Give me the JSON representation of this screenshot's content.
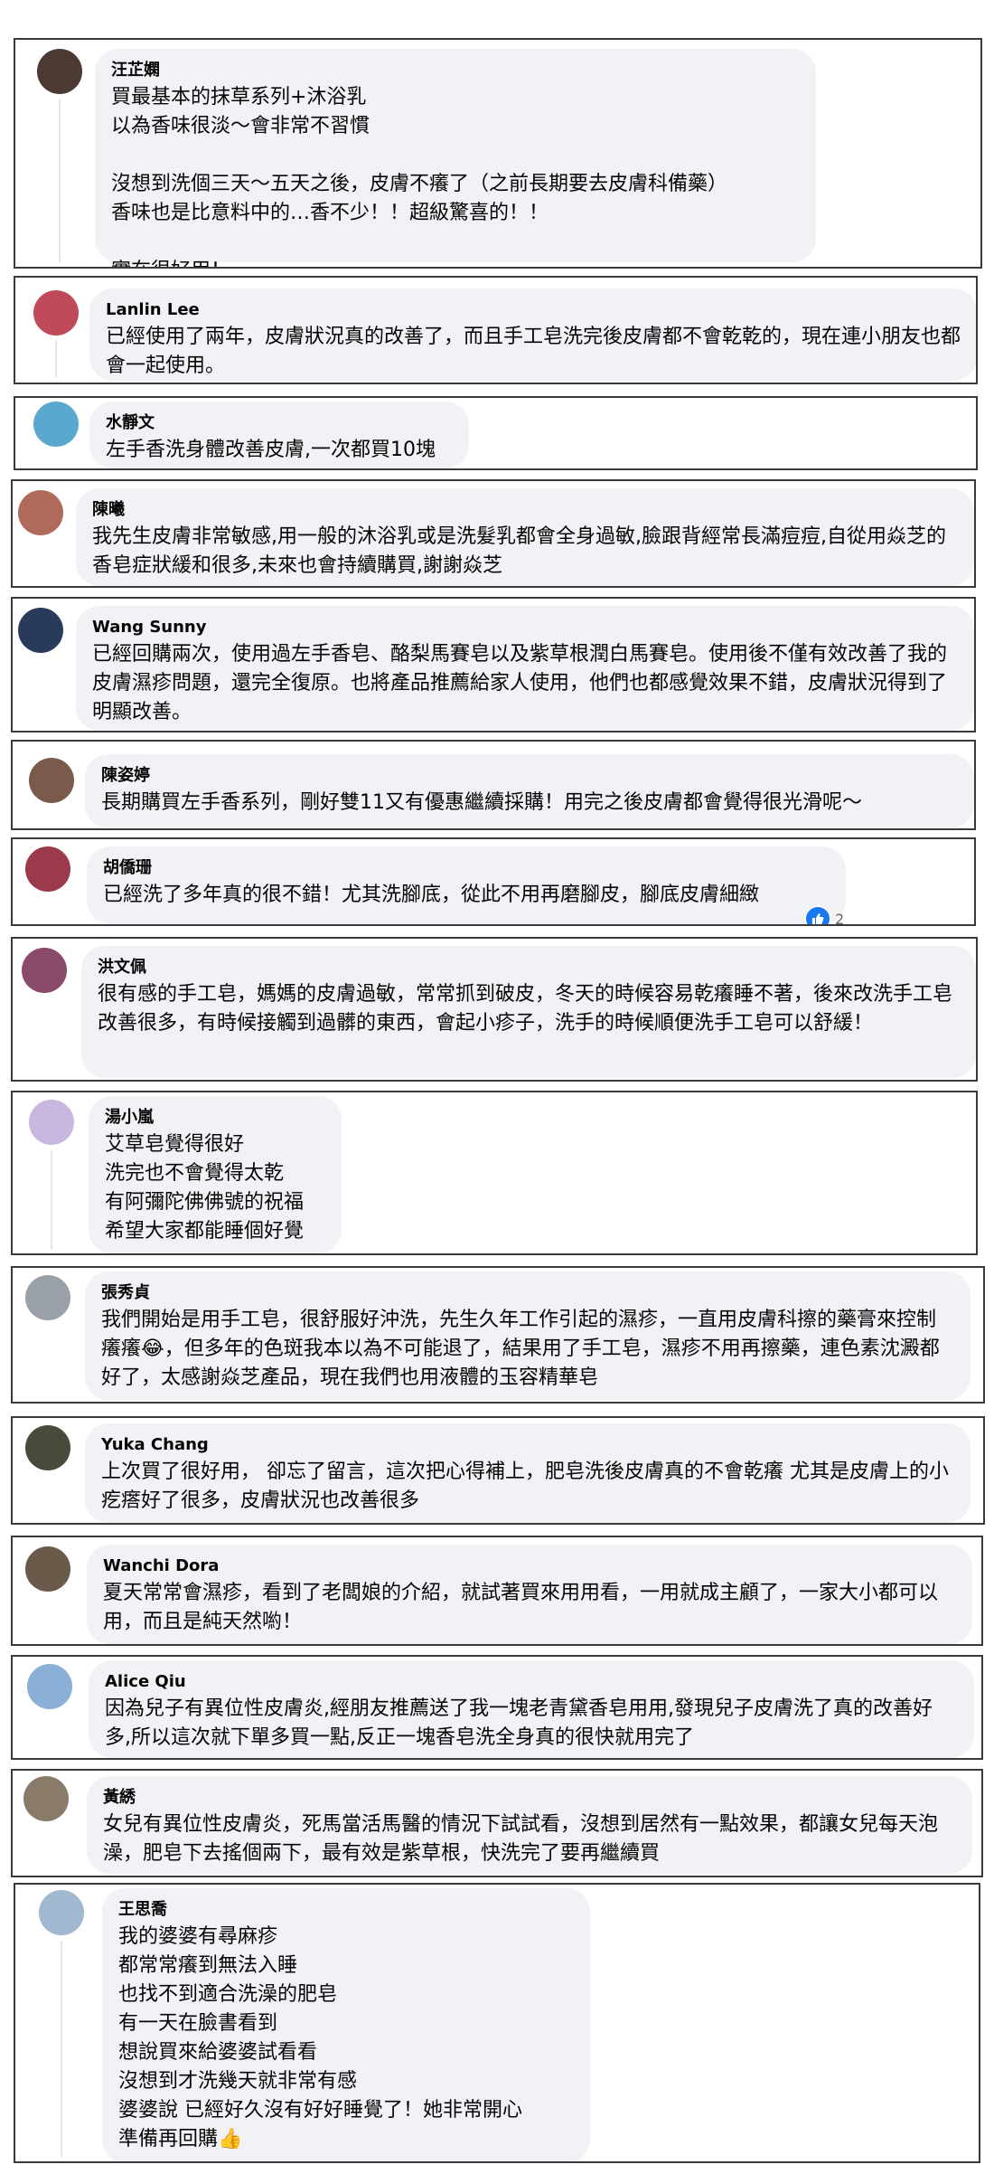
{
  "comments": [
    {
      "name": "汪芷嫻",
      "text": "買最基本的抹草系列+沐浴乳\n以為香味很淡～會非常不習慣\n\n沒想到洗個三天～五天之後，皮膚不癢了（之前長期要去皮膚科備藥）\n香味也是比意料中的…香不少！！超級驚喜的！！\n\n實在很好用！",
      "avatar_color": "#4a3a32"
    },
    {
      "name": "Lanlin Lee",
      "text": "已經使用了兩年，皮膚狀況真的改善了，而且手工皂洗完後皮膚都不會乾乾的，現在連小朋友也都會一起使用。",
      "avatar_color": "#c04a5a"
    },
    {
      "name": "水靜文",
      "text": "左手香洗身體改善皮膚,一次都買10塊",
      "avatar_color": "#5aa8d0"
    },
    {
      "name": "陳曦",
      "text": "我先生皮膚非常敏感,用一般的沐浴乳或是洗髮乳都會全身過敏,臉跟背經常長滿痘痘,自從用焱芝的香皂症狀緩和很多,未來也會持續購買,謝謝焱芝",
      "avatar_color": "#b06a5a"
    },
    {
      "name": "Wang Sunny",
      "text": "已經回購兩次，使用過左手香皂、酪梨馬賽皂以及紫草根潤白馬賽皂。使用後不僅有效改善了我的皮膚濕疹問題，還完全復原。也將產品推薦給家人使用，他們也都感覺效果不錯，皮膚狀況得到了明顯改善。",
      "avatar_color": "#2a3a5a"
    },
    {
      "name": "陳姿婷",
      "text": "長期購買左手香系列，剛好雙11又有優惠繼續採購！用完之後皮膚都會覺得很光滑呢～",
      "avatar_color": "#7a5a4a"
    },
    {
      "name": "胡僑珊",
      "text": "已經洗了多年真的很不錯！尤其洗腳底，從此不用再磨腳皮，腳底皮膚細緻",
      "avatar_color": "#9a3a4a",
      "reaction_count": "2"
    },
    {
      "name": "洪文佩",
      "text": "很有感的手工皂，媽媽的皮膚過敏，常常抓到破皮，冬天的時候容易乾癢睡不著，後來改洗手工皂改善很多，有時候接觸到過髒的東西，會起小疹子，洗手的時候順便洗手工皂可以舒緩！",
      "avatar_color": "#8a4a6a"
    },
    {
      "name": "湯小嵐",
      "text": "艾草皂覺得很好\n洗完也不會覺得太乾\n有阿彌陀佛佛號的祝福\n希望大家都能睡個好覺",
      "avatar_color": "#c8b8e0"
    },
    {
      "name": "張秀貞",
      "text": "我們開始是用手工皂，很舒服好沖洗，先生久年工作引起的濕疹，一直用皮膚科擦的藥膏來控制癢癢😂，但多年的色斑我本以為不可能退了，結果用了手工皂，濕疹不用再擦藥，連色素沈澱都好了，太感謝焱芝產品，現在我們也用液體的玉容精華皂",
      "avatar_color": "#9aa0a8"
    },
    {
      "name": "Yuka Chang",
      "text": "上次買了很好用， 卻忘了留言，這次把心得補上，肥皂洗後皮膚真的不會乾癢 尤其是皮膚上的小疙瘩好了很多，皮膚狀況也改善很多",
      "avatar_color": "#4a4a3a"
    },
    {
      "name": "Wanchi Dora",
      "text": "夏天常常會濕疹，看到了老闆娘的介紹，就試著買來用用看，一用就成主顧了，一家大小都可以用，而且是純天然喲！",
      "avatar_color": "#6a5a4a"
    },
    {
      "name": "Alice Qiu",
      "text": "因為兒子有異位性皮膚炎,經朋友推薦送了我一塊老青黛香皂用用,發現兒子皮膚洗了真的改善好多,所以這次就下單多買一點,反正一塊香皂洗全身真的很快就用完了",
      "avatar_color": "#8ab0d8"
    },
    {
      "name": "黃綉",
      "text": "女兒有異位性皮膚炎，死馬當活馬醫的情況下試試看，沒想到居然有一點效果，都讓女兒每天泡澡，肥皂下去搖個兩下，最有效是紫草根，快洗完了要再繼續買",
      "avatar_color": "#8a7a6a"
    },
    {
      "name": "王思喬",
      "text": "我的婆婆有尋麻疹\n都常常癢到無法入睡\n也找不到適合洗澡的肥皂\n有一天在臉書看到\n想說買來給婆婆試看看\n沒想到才洗幾天就非常有感\n婆婆說 已經好久沒有好好睡覺了！她非常開心\n準備再回購👍",
      "avatar_color": "#a0b8d0"
    }
  ]
}
